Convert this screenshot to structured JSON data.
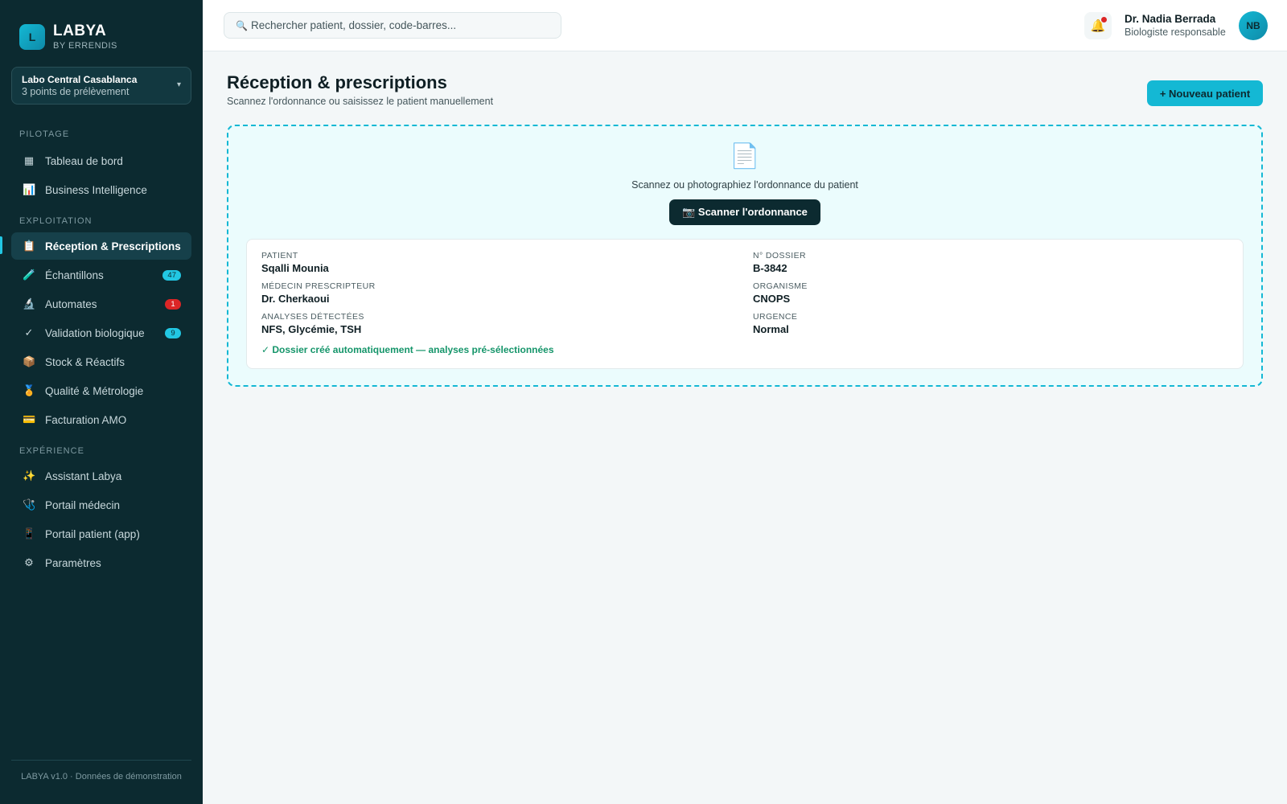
{
  "brand": {
    "logo": "L",
    "name": "LABYA",
    "sub": "BY ERRENDIS"
  },
  "lab": {
    "name": "Labo Central Casablanca",
    "sub": "3 points de prélèvement",
    "chevron": "▾"
  },
  "sections": {
    "pilotage": "PILOTAGE",
    "exploitation": "EXPLOITATION",
    "experience": "EXPÉRIENCE"
  },
  "nav": [
    {
      "icon": "▦",
      "icon_name": "dashboard-grid-icon",
      "label": "Tableau de bord"
    },
    {
      "icon": "📊",
      "icon_name": "bar-chart-icon",
      "label": "Business Intelligence"
    },
    {
      "icon": "📋",
      "icon_name": "clipboard-icon",
      "label": "Réception & Prescriptions",
      "active": true
    },
    {
      "icon": "🧪",
      "icon_name": "test-tube-icon",
      "label": "Échantillons",
      "badge": "47"
    },
    {
      "icon": "🔬",
      "icon_name": "microscope-icon",
      "label": "Automates",
      "badge": "1"
    },
    {
      "icon": "✓",
      "icon_name": "checkmark-icon",
      "label": "Validation biologique",
      "badge": "9"
    },
    {
      "icon": "📦",
      "icon_name": "package-icon",
      "label": "Stock & Réactifs"
    },
    {
      "icon": "🏅",
      "icon_name": "medal-icon",
      "label": "Qualité & Métrologie"
    },
    {
      "icon": "💳",
      "icon_name": "credit-card-icon",
      "label": "Facturation AMO"
    },
    {
      "icon": "✨",
      "icon_name": "sparkles-icon",
      "label": "Assistant Labya"
    },
    {
      "icon": "🩺",
      "icon_name": "stethoscope-icon",
      "label": "Portail médecin"
    },
    {
      "icon": "📱",
      "icon_name": "mobile-phone-icon",
      "label": "Portail patient (app)"
    },
    {
      "icon": "⚙",
      "icon_name": "gear-icon",
      "label": "Paramètres"
    }
  ],
  "footer": "LABYA v1.0 · Données de démonstration",
  "search": {
    "icon": "🔍",
    "placeholder": "Rechercher patient, dossier, code-barres..."
  },
  "notifications": {
    "icon": "🔔"
  },
  "user": {
    "name": "Dr. Nadia Berrada",
    "role": "Biologiste responsable",
    "initials": "NB"
  },
  "page": {
    "title": "Réception & prescriptions",
    "subtitle": "Scannez l'ordonnance ou saisissez le patient manuellement",
    "new_patient_label": "+ Nouveau patient"
  },
  "scan": {
    "doc_icon": "📄",
    "instruction": "Scannez ou photographiez l'ordonnance du patient",
    "button_label": "📷 Scanner l'ordonnance"
  },
  "result": {
    "patient": {
      "label": "PATIENT",
      "value": "Sqalli Mounia"
    },
    "dossier": {
      "label": "N° DOSSIER",
      "value": "B-3842"
    },
    "medecin": {
      "label": "MÉDECIN PRESCRIPTEUR",
      "value": "Dr. Cherkaoui"
    },
    "organisme": {
      "label": "ORGANISME",
      "value": "CNOPS"
    },
    "analyses": {
      "label": "ANALYSES DÉTECTÉES",
      "value": "NFS, Glycémie, TSH"
    },
    "urgence": {
      "label": "URGENCE",
      "value": "Normal"
    },
    "success": "✓ Dossier créé automatiquement — analyses pré-sélectionnées"
  },
  "colors": {
    "sidebar_bg": "#0c2a30",
    "accent": "#14b8d4",
    "success": "#15956a",
    "danger": "#dc2626"
  }
}
